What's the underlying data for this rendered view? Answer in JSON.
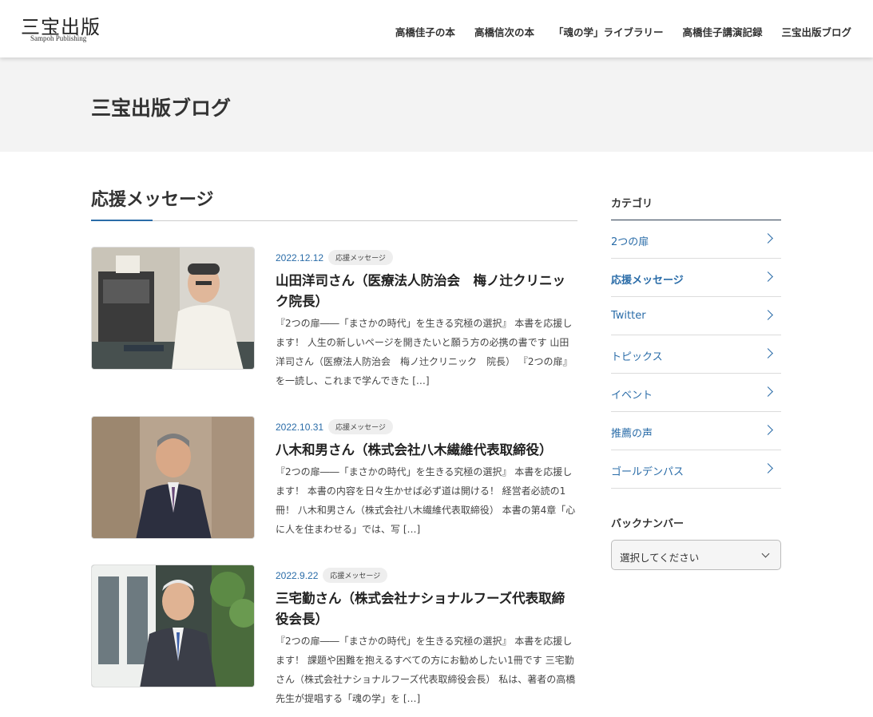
{
  "header": {
    "logo_ja": "三宝出版",
    "logo_en": "Sampoh Publishing",
    "nav": [
      "高橋佳子の本",
      "高橋信次の本",
      "「魂の学」ライブラリー",
      "高橋佳子講演記録",
      "三宝出版ブログ"
    ]
  },
  "page_title": "三宝出版ブログ",
  "section_title": "応援メッセージ",
  "posts": [
    {
      "date": "2022.12.12",
      "category": "応援メッセージ",
      "title": "山田洋司さん（医療法人防治会　梅ノ辻クリニック院長）",
      "excerpt": "『2つの扉――「まさかの時代」を生きる究極の選択』 本書を応援します！ 人生の新しいページを開きたいと願う方の必携の書です 山田洋司さん（医療法人防治会　梅ノ辻クリニック　院長） 『2つの扉』を一読し、これまで学んできた […]"
    },
    {
      "date": "2022.10.31",
      "category": "応援メッセージ",
      "title": "八木和男さん（株式会社八木繊維代表取締役）",
      "excerpt": "『2つの扉――「まさかの時代」を生きる究極の選択』 本書を応援します！ 本書の内容を日々生かせば必ず道は開ける！ 経営者必読の1冊！ 八木和男さん（株式会社八木繊維代表取締役） 本書の第4章「心に人を住まわせる」では、写 […]"
    },
    {
      "date": "2022.9.22",
      "category": "応援メッセージ",
      "title": "三宅勤さん（株式会社ナショナルフーズ代表取締役会長）",
      "excerpt": "『2つの扉――「まさかの時代」を生きる究極の選択』 本書を応援します！ 課題や困難を抱えるすべての方にお勧めしたい1冊です 三宅勤さん（株式会社ナショナルフーズ代表取締役会長） 私は、著者の高橋先生が提唱する「魂の学」を […]"
    }
  ],
  "sidebar": {
    "category_heading": "カテゴリ",
    "categories": [
      "2つの扉",
      "応援メッセージ",
      "Twitter",
      "トピックス",
      "イベント",
      "推薦の声",
      "ゴールデンパス"
    ],
    "active_category": "応援メッセージ",
    "backnumber_heading": "バックナンバー",
    "backnumber_select": "選択してください"
  },
  "colors": {
    "accent": "#2a6ca8",
    "title_band": "#f3f3f3"
  }
}
